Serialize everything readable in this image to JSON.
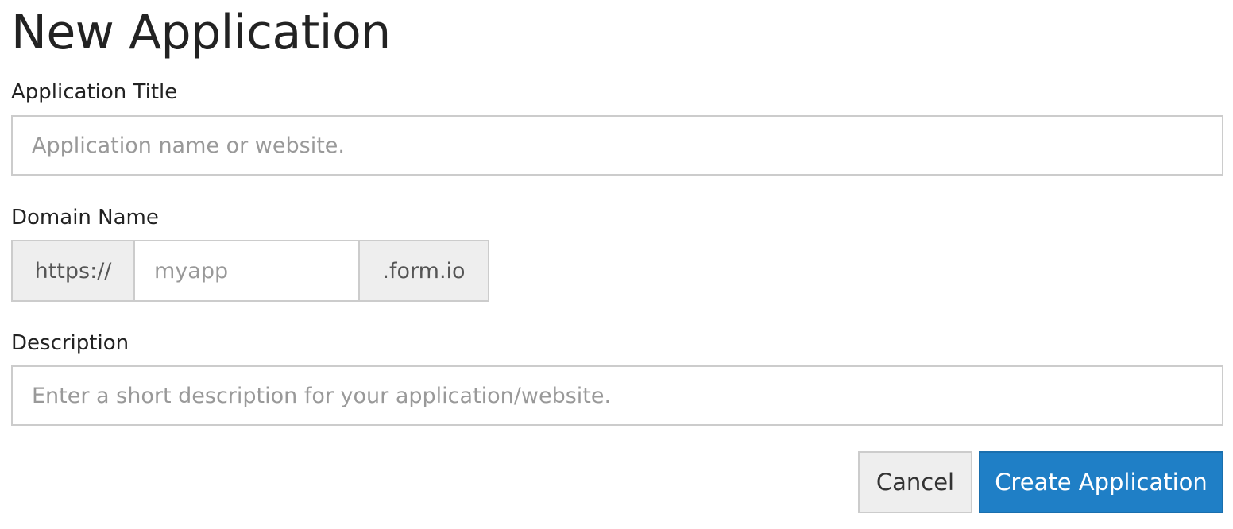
{
  "page": {
    "title": "New Application"
  },
  "form": {
    "title_field": {
      "label": "Application Title",
      "value": "",
      "placeholder": "Application name or website."
    },
    "domain_field": {
      "label": "Domain Name",
      "prefix": "https://",
      "value": "",
      "placeholder": "myapp",
      "suffix": ".form.io"
    },
    "description_field": {
      "label": "Description",
      "value": "",
      "placeholder": "Enter a short description for your application/website."
    }
  },
  "actions": {
    "cancel_label": "Cancel",
    "create_label": "Create Application"
  },
  "colors": {
    "primary": "#1f7fc6",
    "addon_background": "#eeeeee",
    "border": "#cccccc"
  }
}
